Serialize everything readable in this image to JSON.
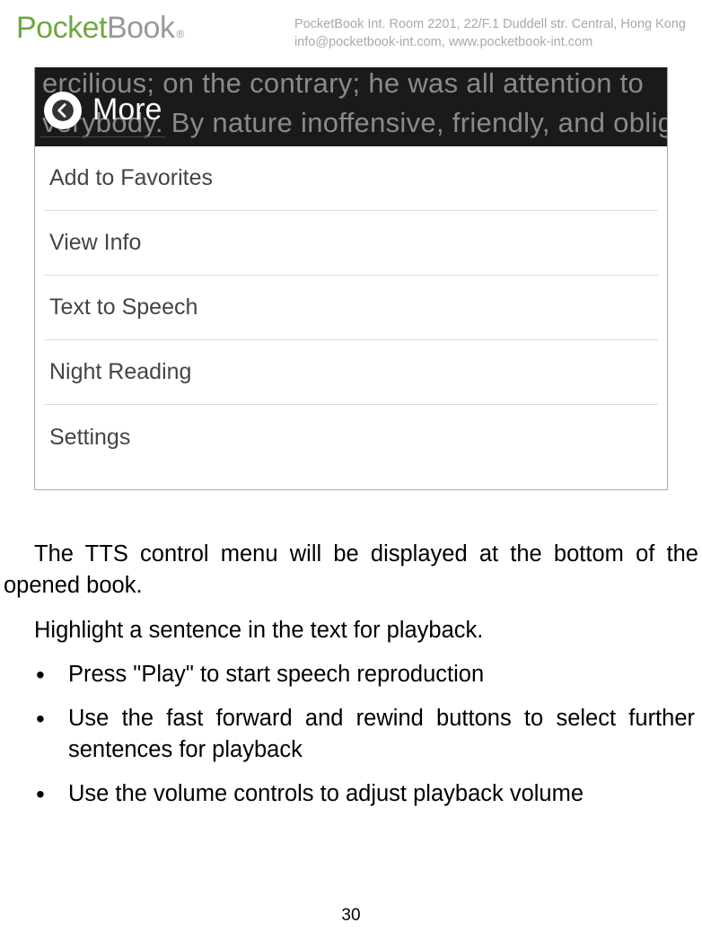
{
  "header": {
    "logo_pocket": "Pocket",
    "logo_book": "Book",
    "logo_trademark": "®",
    "contact_line1": "PocketBook Int. Room 2201, 22/F.1 Duddell str. Central, Hong Kong",
    "contact_line2": "info@pocketbook-int.com, www.pocketbook-int.com"
  },
  "screenshot": {
    "book_line1": "ercilious; on the contrary; he was all attention to",
    "book_line2": "verybody. By nature inoffensive, friendly, and oblig",
    "more_label": "More",
    "menu_items": [
      {
        "label": "Add to Favorites"
      },
      {
        "label": "View Info"
      },
      {
        "label": "Text to Speech"
      },
      {
        "label": "Night Reading"
      },
      {
        "label": "Settings"
      }
    ]
  },
  "body": {
    "para1": "The TTS control menu will be displayed at the bottom of the opened book.",
    "para2": "Highlight a sentence in the text for playback.",
    "bullets": [
      "Press \"Play\" to start speech reproduction",
      "Use the fast forward and rewind buttons to select further sentences for playback",
      "Use the volume controls to adjust playback volume"
    ]
  },
  "page_number": "30"
}
